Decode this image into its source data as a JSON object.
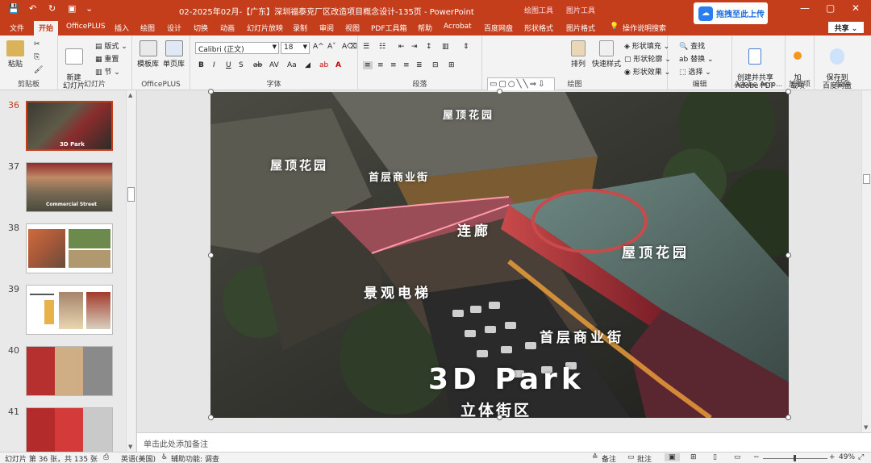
{
  "app": {
    "title": "02-2025年02月-【广东】深圳福泰克厂区改造项目概念设计-135页 - PowerPoint",
    "context_tabs": [
      "绘图工具",
      "图片工具"
    ],
    "upload_label": "拖拽至此上传",
    "share_label": "共享"
  },
  "tabs": [
    "文件",
    "开始",
    "OfficePLUS",
    "插入",
    "绘图",
    "设计",
    "切换",
    "动画",
    "幻灯片放映",
    "录制",
    "审阅",
    "视图",
    "PDF工具箱",
    "帮助",
    "Acrobat",
    "百度网盘",
    "形状格式",
    "图片格式",
    "操作说明搜索"
  ],
  "ribbon": {
    "clipboard": {
      "label": "剪贴板",
      "paste": "粘贴"
    },
    "slides": {
      "label": "幻灯片",
      "new_slide": "新建\n幻灯片",
      "layout": "版式",
      "reset": "重置",
      "section": "节"
    },
    "officeplus": {
      "label": "OfficePLUS",
      "template": "模板库",
      "single": "单页库"
    },
    "font": {
      "label": "字体",
      "font_name": "Calibri (正文)",
      "font_size": "18"
    },
    "paragraph": {
      "label": "段落"
    },
    "drawing": {
      "label": "绘图",
      "arrange": "排列",
      "quick_styles": "快速样式",
      "fill": "形状填充",
      "outline": "形状轮廓",
      "effects": "形状效果"
    },
    "editing": {
      "label": "编辑",
      "find": "查找",
      "replace": "替换",
      "select": "选择"
    },
    "adobe": {
      "label": "Adobe Acro...",
      "create": "创建并共享\nAdobe PDF"
    },
    "addins": {
      "label": "加载项",
      "btn": "加\n载项"
    },
    "save": {
      "label": "保存",
      "btn": "保存到\n百度网盘"
    }
  },
  "thumbnails": [
    {
      "num": "36",
      "selected": true,
      "caption": "3D Park"
    },
    {
      "num": "37",
      "selected": false,
      "caption": "Commercial Street"
    },
    {
      "num": "38",
      "selected": false,
      "caption": ""
    },
    {
      "num": "39",
      "selected": false,
      "caption": ""
    },
    {
      "num": "40",
      "selected": false,
      "caption": ""
    },
    {
      "num": "41",
      "selected": false,
      "caption": ""
    }
  ],
  "slide_labels": {
    "roof1": "屋顶花园",
    "roof2": "屋顶花园",
    "roof3": "屋顶花园",
    "street1": "首层商业街",
    "street2": "首层商业街",
    "corridor": "连廊",
    "escalator": "景观电梯",
    "main_title": "3D Park",
    "sub_title": "立体街区"
  },
  "notes_placeholder": "单击此处添加备注",
  "status": {
    "slide_info": "幻灯片 第 36 张，共 135 张",
    "language": "英语(美国)",
    "accessibility": "辅助功能: 调查",
    "notes": "备注",
    "comments": "批注",
    "zoom": "49%"
  },
  "colors": {
    "accent": "#c43e1c",
    "ribbon_bg": "#f3f3f3"
  }
}
